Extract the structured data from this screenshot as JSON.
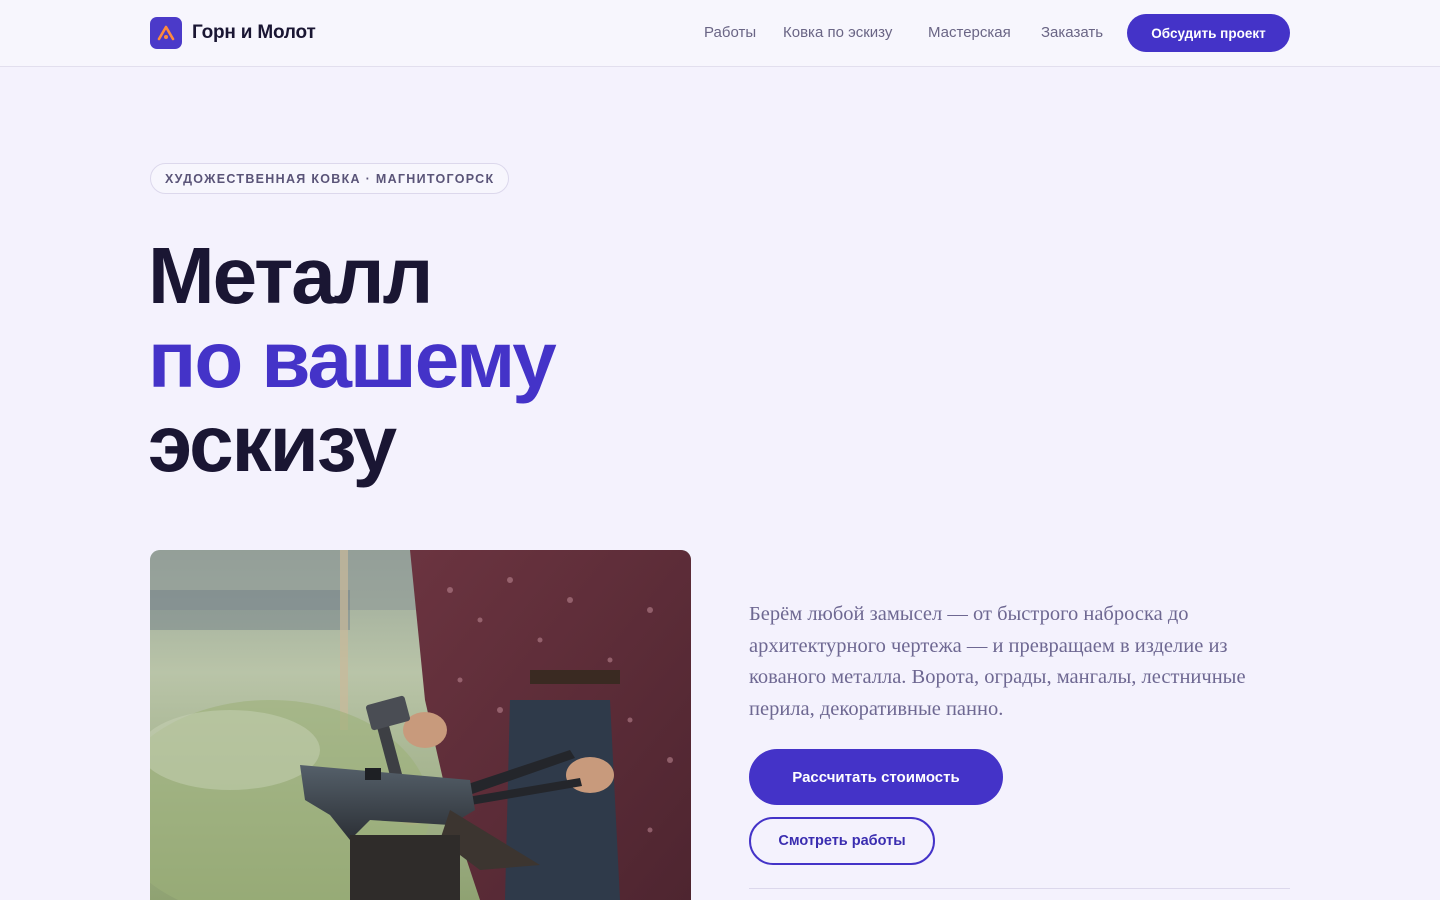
{
  "header": {
    "brand_name": "Горн и Молот",
    "brand_icon": "forge-logo-icon",
    "nav": [
      "Работы",
      "Ковка по эскизу",
      "Мастерская",
      "Заказать"
    ],
    "cta": "Обсудить проект"
  },
  "hero": {
    "eyebrow": "ХУДОЖЕСТВЕННАЯ КОВКА · МАГНИТОГОРСК",
    "title_line1": "Металл",
    "title_line2": "по вашему",
    "title_line3": "эскизу",
    "lead": "Берём любой замысел — от быстрого наброска до архитектурного чертежа — и превращаем в изделие из кованого металла. Ворота, ограды, мангалы, лестничные перила, декоративные панно.",
    "primary_button": "Рассчитать стоимость",
    "secondary_button": "Смотреть работы"
  },
  "colors": {
    "accent": "#4433c8",
    "text": "#1a1633",
    "muted": "#6e6892",
    "background": "#f4f2fd"
  }
}
